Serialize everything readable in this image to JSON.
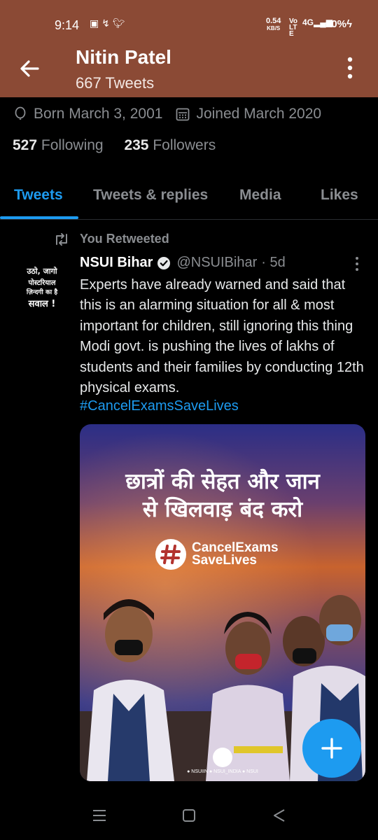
{
  "status_bar": {
    "time": "9:14",
    "left_icons": [
      "news-app-icon",
      "missed-call-icon",
      "twitter-icon"
    ],
    "net_speed_value": "0.54",
    "net_speed_unit": "KB/S",
    "volte": "Vo LTE",
    "network": "4G",
    "battery": "90%"
  },
  "header": {
    "name": "Nitin Patel",
    "tweet_count": "667 Tweets",
    "bg_color": "#8b4a35"
  },
  "profile": {
    "born": "Born March 3, 2001",
    "joined": "Joined March 2020",
    "following_count": "527",
    "following_label": "Following",
    "followers_count": "235",
    "followers_label": "Followers"
  },
  "tabs": [
    {
      "label": "Tweets",
      "active": true
    },
    {
      "label": "Tweets & replies",
      "active": false
    },
    {
      "label": "Media",
      "active": false
    },
    {
      "label": "Likes",
      "active": false
    }
  ],
  "tweet": {
    "retweet_label": "You Retweeted",
    "avatar_lines": [
      "उठो, जागो",
      "पोस्टरियाल",
      "ज़िन्दगी का है",
      "सवाल !"
    ],
    "name": "NSUI Bihar",
    "handle": "@NSUIBihar",
    "time": "· 5d",
    "text": "Experts have already warned and said that this is an alarming situation for all & most important for children, still ignoring this thing Modi govt. is pushing the lives of lakhs of students and their families by conducting 12th physical exams.",
    "hashtag": "#CancelExamsSaveLives",
    "image": {
      "headline_line1": "छात्रों की सेहत और जान",
      "headline_line2": "से खिलवाड़ बंद करो",
      "tag_line1": "CancelExams",
      "tag_line2": "SaveLives",
      "footer_social": "● NSUIIN   ● NSUI_INDIA   ● NSUI"
    }
  },
  "colors": {
    "accent": "#1d9bf0",
    "muted_text": "#8a8d91",
    "background": "#000000"
  }
}
